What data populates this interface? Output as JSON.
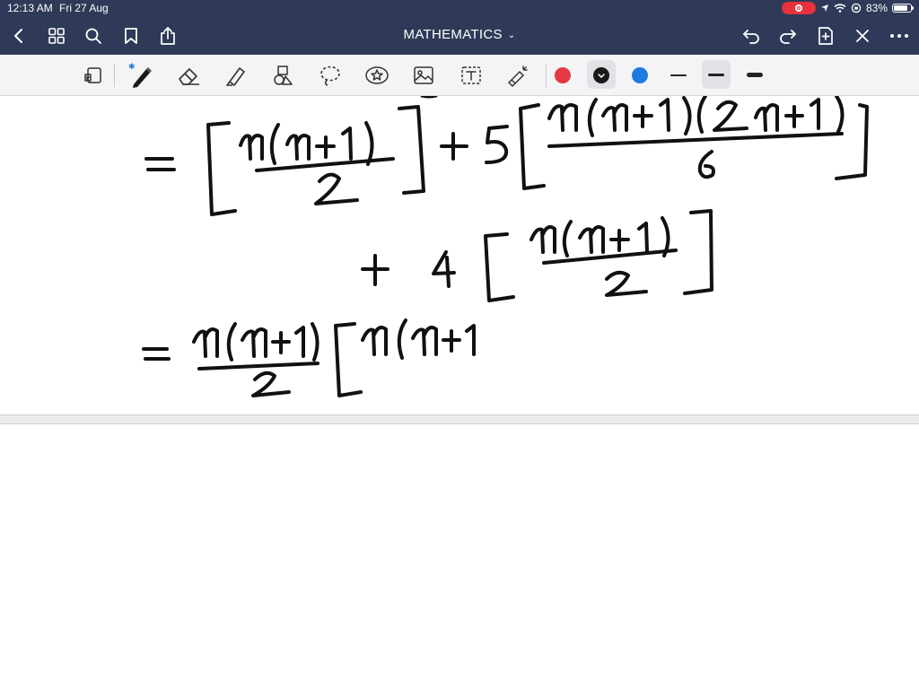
{
  "status_bar": {
    "time": "12:13 AM",
    "date": "Fri 27 Aug",
    "battery_percent": "83%",
    "battery_level": 0.83,
    "icons": [
      "screen-record-icon",
      "location-icon",
      "wifi-icon",
      "orientation-lock-icon",
      "battery-icon"
    ]
  },
  "nav_bar": {
    "title": "MATHEMATICS",
    "left_icons": [
      "back-icon",
      "grid-view-icon",
      "search-icon",
      "bookmark-icon",
      "share-icon"
    ],
    "right_icons": [
      "undo-icon",
      "redo-icon",
      "add-page-icon",
      "close-icon",
      "more-icon"
    ]
  },
  "toolbar": {
    "tools": [
      "page-reader-icon",
      "pen-icon",
      "eraser-icon",
      "highlighter-icon",
      "shapes-icon",
      "lasso-icon",
      "sticker-icon",
      "image-icon",
      "text-icon",
      "laser-pointer-icon"
    ],
    "colors": [
      "#e53845",
      "#1a1a1a",
      "#1f7ae0"
    ],
    "selected_color": "#1a1a1a",
    "stroke_widths": [
      "thin",
      "medium",
      "thick"
    ],
    "selected_stroke": "medium"
  },
  "colors": {
    "nav_background": "#2e3a57",
    "toolbar_background": "#f4f4f6",
    "ink": "#111111"
  }
}
